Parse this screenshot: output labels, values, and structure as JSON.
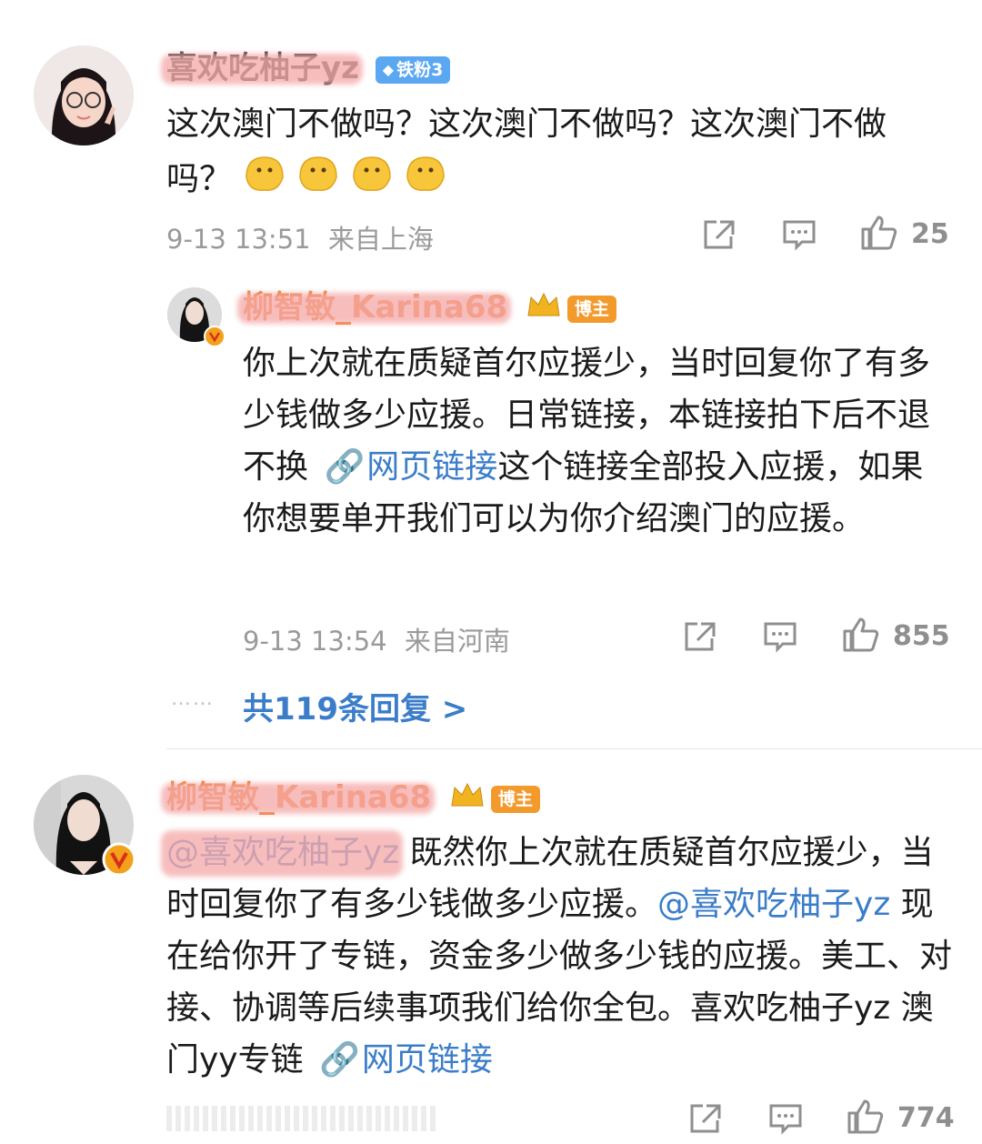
{
  "comment1": {
    "username": "喜欢吃柚子yz",
    "badge": "铁粉3",
    "text": "这次澳门不做吗？这次澳门不做吗？这次澳门不做吗？",
    "emoji_count": 4,
    "time": "9-13 13:51",
    "location": "来自上海",
    "likes": "25"
  },
  "reply1": {
    "username": "柳智敏_Karina68",
    "badge": "博主",
    "text_part1": "你上次就在质疑首尔应援少，当时回复你了有多少钱做多少应援。日常链接，本链接拍下后不退不换",
    "link_label": "网页链接",
    "text_part2": "这个链接全部投入应援，如果你想要单开我们可以为你介绍澳门的应援。",
    "time": "9-13 13:54",
    "location": "来自河南",
    "likes": "855",
    "more_replies": "共119条回复 >",
    "dots": "……"
  },
  "comment2": {
    "username": "柳智敏_Karina68",
    "badge": "博主",
    "mention1": "@喜欢吃柚子yz",
    "text_part1": "既然你上次就在质疑首尔应援少，当时回复你了有多少钱做多少应援。",
    "mention2": "@喜欢吃柚子yz",
    "text_part2": "现在给你开了专链，资金多少做多少钱的应援。美工、对接、协调等后续事项我们给你全包。喜欢吃柚子yz 澳门yy专链",
    "link_label": "网页链接",
    "likes": "774"
  },
  "colors": {
    "link": "#3b7dc9",
    "vip_name": "#f07a24",
    "fan_badge": "#5aa7f2",
    "blogger_badge": "#f29a2c",
    "verified": "#f3a11a",
    "meta": "#9a9a9a"
  },
  "icons": [
    "share-icon",
    "comment-icon",
    "like-icon",
    "crown-icon",
    "diamond-icon",
    "verified-icon",
    "link-icon",
    "emoji-icon"
  ]
}
